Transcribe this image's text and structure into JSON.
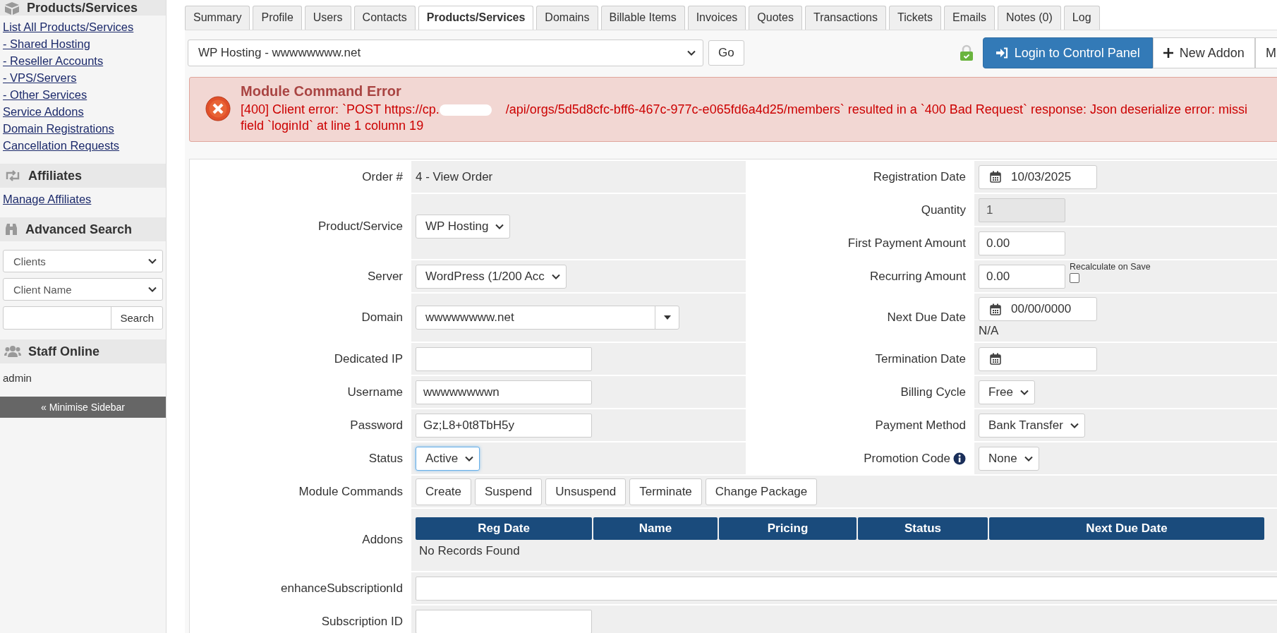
{
  "sidebar": {
    "sections": [
      {
        "kind": "links",
        "title": "Products/Services",
        "links": [
          "List All Products/Services",
          "- Shared Hosting",
          "- Reseller Accounts",
          "- VPS/Servers",
          "- Other Services",
          "Service Addons",
          "Domain Registrations",
          "Cancellation Requests"
        ]
      },
      {
        "kind": "links",
        "title": "Affiliates",
        "links": [
          "Manage Affiliates"
        ]
      },
      {
        "kind": "search",
        "title": "Advanced Search",
        "selects": [
          "Clients",
          "Client Name"
        ],
        "button": "Search"
      },
      {
        "kind": "staff",
        "title": "Staff Online",
        "staff": [
          "admin"
        ]
      }
    ],
    "minimise_button": "« Minimise Sidebar"
  },
  "tabs": [
    {
      "label": "Summary",
      "selected": false
    },
    {
      "label": "Profile",
      "selected": false
    },
    {
      "label": "Users",
      "selected": false
    },
    {
      "label": "Contacts",
      "selected": false
    },
    {
      "label": "Products/Services",
      "selected": true
    },
    {
      "label": "Domains",
      "selected": false
    },
    {
      "label": "Billable Items",
      "selected": false
    },
    {
      "label": "Invoices",
      "selected": false
    },
    {
      "label": "Quotes",
      "selected": false
    },
    {
      "label": "Transactions",
      "selected": false
    },
    {
      "label": "Tickets",
      "selected": false
    },
    {
      "label": "Emails",
      "selected": false
    },
    {
      "label": "Notes (0)",
      "selected": false
    },
    {
      "label": "Log",
      "selected": false
    }
  ],
  "toolbar": {
    "service_select": "WP Hosting - wwwwwwww.net",
    "go_button": "Go",
    "buttons": [
      {
        "label": "Login to Control Panel",
        "kind": "primary"
      },
      {
        "label": "New Addon",
        "kind": "add"
      },
      {
        "label": "M",
        "kind": "more"
      }
    ]
  },
  "error": {
    "title": "Module Command Error",
    "line_1_start": "[400] Client error: `POST https://cp.",
    "line_1_end": "/api/orgs/5d5d8cfc-bff6-467c-977c-e065fd6a4d25/members` resulted in a `400 Bad Request` response: Json deserialize error: missi",
    "line_2": "field `loginId` at line 1 column 19"
  },
  "form": {
    "left": [
      {
        "label": "Order #",
        "kind": "static",
        "value": "4 - View Order"
      },
      {
        "label": "Product/Service",
        "kind": "select",
        "value": "WP Hosting"
      },
      {
        "label": "Server",
        "kind": "select",
        "value": "WordPress (1/200 Acc"
      },
      {
        "label": "Domain",
        "kind": "combo",
        "value": "wwwwwwww.net"
      },
      {
        "label": "Dedicated IP",
        "kind": "input"
      },
      {
        "label": "Username",
        "kind": "input",
        "value": "wwwwwwwwn"
      },
      {
        "label": "Password",
        "kind": "input",
        "value": "Gz;L8+0t8TbH5y"
      },
      {
        "label": "Status",
        "kind": "select",
        "value": "Active",
        "focused": true
      }
    ],
    "right": [
      {
        "label": "Registration Date",
        "kind": "date",
        "value": "10/03/2025"
      },
      {
        "label": "Quantity",
        "kind": "input",
        "value": "1",
        "disabled": true
      },
      {
        "label": "First Payment Amount",
        "kind": "input",
        "value": "0.00"
      },
      {
        "label": "Recurring Amount",
        "kind": "input",
        "value": "0.00",
        "checkbox": {
          "label": "Recalculate on Save",
          "checked": false
        }
      },
      {
        "label": "Next Due Date",
        "kind": "date",
        "value": "00/00/0000",
        "note": "N/A"
      },
      {
        "label": "Termination Date",
        "kind": "date"
      },
      {
        "label": "Billing Cycle",
        "kind": "select",
        "value": "Free"
      },
      {
        "label": "Payment Method",
        "kind": "select",
        "value": "Bank Transfer"
      },
      {
        "label": "Promotion Code",
        "kind": "select",
        "value": "None",
        "info": true
      }
    ],
    "module_commands": {
      "label": "Module Commands",
      "buttons": [
        "Create",
        "Suspend",
        "Unsuspend",
        "Terminate",
        "Change Package"
      ]
    },
    "addons": {
      "label": "Addons",
      "columns": [
        "Reg Date",
        "Name",
        "Pricing",
        "Status",
        "Next Due Date"
      ],
      "empty_text": "No Records Found"
    },
    "extra_fields": [
      {
        "label": "enhanceSubscriptionId",
        "kind": "wide"
      },
      {
        "label": "Subscription ID",
        "kind": "input"
      }
    ]
  }
}
